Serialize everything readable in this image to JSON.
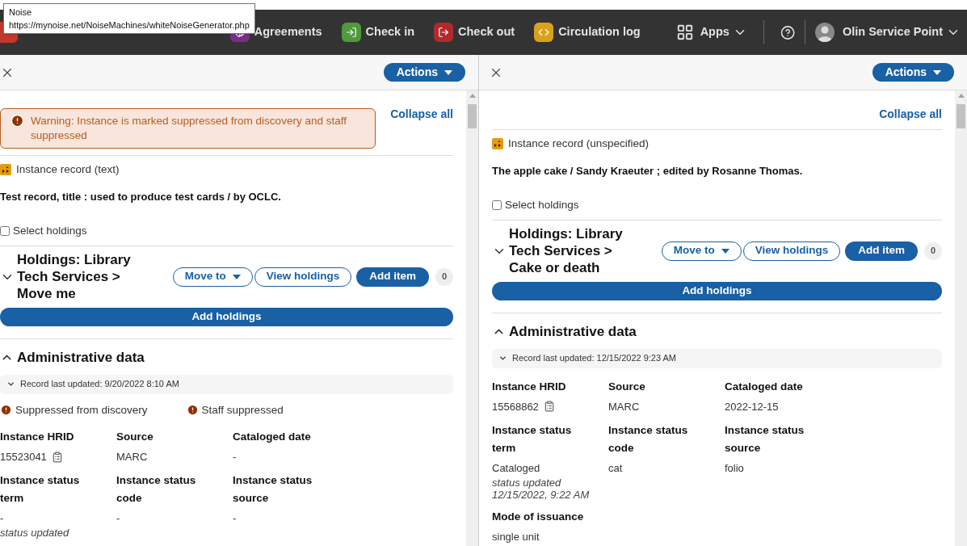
{
  "tooltip": {
    "title": "Noise",
    "url": "https://mynoise.net/NoiseMachines/whiteNoiseGenerator.php"
  },
  "header": {
    "nav": [
      {
        "label": "Agreements",
        "color": "#7b2d8e"
      },
      {
        "label": "Check in",
        "color": "#4f9a3a"
      },
      {
        "label": "Check out",
        "color": "#b02a2a"
      },
      {
        "label": "Circulation log",
        "color": "#d9a21b"
      }
    ],
    "apps": "Apps",
    "user": "Olin Service Point"
  },
  "panes": [
    {
      "actions": "Actions",
      "collapse_all": "Collapse all",
      "warning": "Warning: Instance is marked suppressed from discovery and staff suppressed",
      "record_type": "Instance record (text)",
      "title": "Test record, title : used to produce test cards / by OCLC.",
      "select_holdings": {
        "label": "Select holdings",
        "checked": false
      },
      "holdings": {
        "title": "Holdings: Library Tech Services > Move me",
        "expanded": false,
        "move_to": "Move to",
        "view": "View holdings",
        "add_item": "Add item",
        "count": "0"
      },
      "add_holdings": "Add holdings",
      "admin": {
        "title": "Administrative data",
        "expanded": true,
        "last_updated": "Record last updated: 9/20/2022 8:10 AM",
        "flags": [
          "Suppressed from discovery",
          "Staff suppressed"
        ],
        "fields": [
          {
            "label": "Instance HRID",
            "value": "15523041",
            "copy": true
          },
          {
            "label": "Source",
            "value": "MARC"
          },
          {
            "label": "Cataloged date",
            "value": "-"
          },
          {
            "label": "Instance status term",
            "value": "-",
            "note": "status updated"
          },
          {
            "label": "Instance status code",
            "value": "-"
          },
          {
            "label": "Instance status source",
            "value": "-"
          }
        ]
      }
    },
    {
      "actions": "Actions",
      "collapse_all": "Collapse all",
      "record_type": "Instance record (unspecified)",
      "title": "The apple cake / Sandy Kraeuter ; edited by Rosanne Thomas.",
      "select_holdings": {
        "label": "Select holdings",
        "checked": false
      },
      "holdings": {
        "title": "Holdings: Library Tech Services > Cake or death",
        "expanded": false,
        "move_to": "Move to",
        "view": "View holdings",
        "add_item": "Add item",
        "count": "0"
      },
      "add_holdings": "Add holdings",
      "admin": {
        "title": "Administrative data",
        "expanded": true,
        "last_updated": "Record last updated: 12/15/2022 9:23 AM",
        "fields": [
          {
            "label": "Instance HRID",
            "value": "15568862",
            "copy": true
          },
          {
            "label": "Source",
            "value": "MARC"
          },
          {
            "label": "Cataloged date",
            "value": "2022-12-15"
          },
          {
            "label": "Instance status term",
            "value": "Cataloged",
            "note": "status updated 12/15/2022, 9:22 AM"
          },
          {
            "label": "Instance status code",
            "value": "cat"
          },
          {
            "label": "Instance status source",
            "value": "folio"
          },
          {
            "label": "Mode of issuance",
            "value": "single unit"
          }
        ]
      }
    }
  ]
}
